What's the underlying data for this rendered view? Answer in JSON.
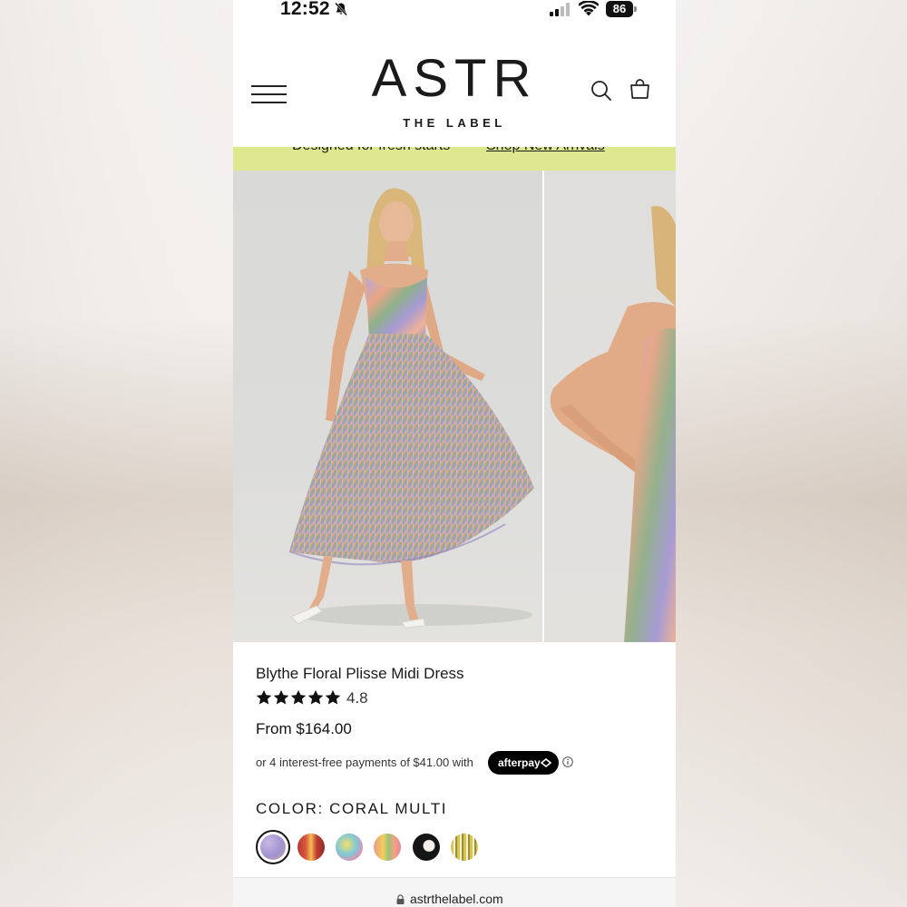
{
  "status_bar": {
    "time": "12:52",
    "battery": "86"
  },
  "header": {
    "logo": "ASTR",
    "logo_subtitle": "THE LABEL"
  },
  "promo": {
    "text": "Designed for fresh starts",
    "link": "Shop New Arrivals",
    "color": "#dde88f"
  },
  "product": {
    "title": "Blythe Floral Plisse Midi Dress",
    "rating": "4.8",
    "stars": 5,
    "price": "From $164.00",
    "afterpay_text": "or 4 interest-free payments of $41.00 with",
    "afterpay_brand": "afterpay",
    "color_label": "COLOR:",
    "color_value": "CORAL MULTI",
    "swatches": [
      {
        "name": "coral-multi",
        "selected": true
      },
      {
        "name": "red-multi",
        "selected": false
      },
      {
        "name": "blue-multi",
        "selected": false
      },
      {
        "name": "yellow-multi",
        "selected": false
      },
      {
        "name": "black-multi",
        "selected": false
      },
      {
        "name": "olive-stripe",
        "selected": false
      }
    ]
  },
  "browser": {
    "url": "astrthelabel.com"
  }
}
